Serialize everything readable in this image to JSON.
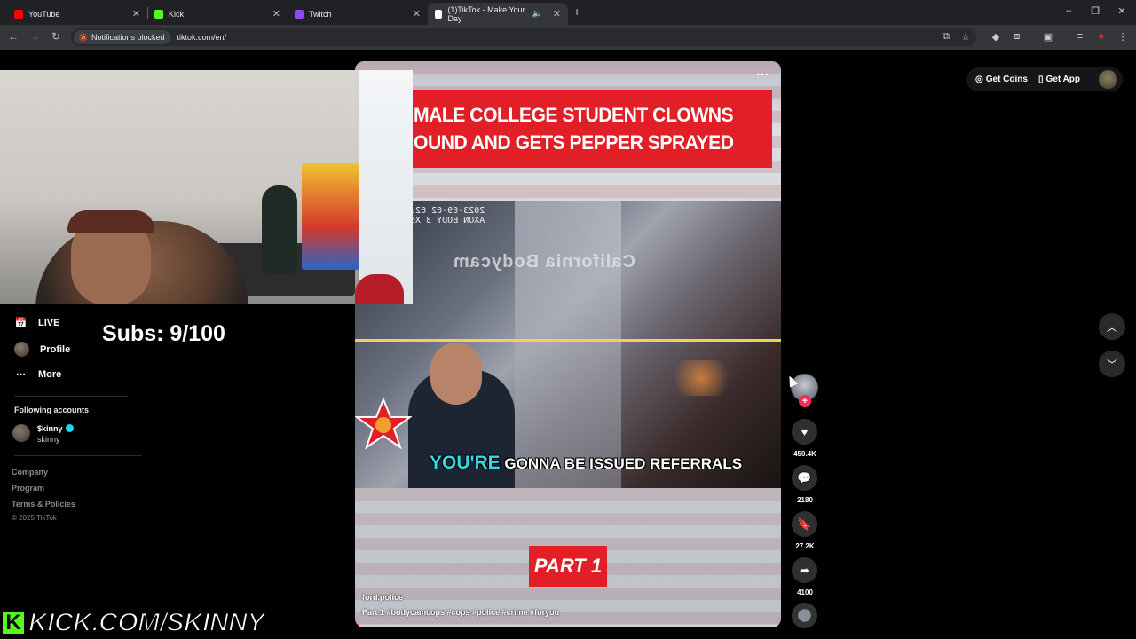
{
  "browser": {
    "tabs": [
      {
        "label": "YouTube",
        "fav_color": "#ff0000",
        "active": false
      },
      {
        "label": "Kick",
        "fav_color": "#53fc18",
        "active": false
      },
      {
        "label": "Twitch",
        "fav_color": "#9146ff",
        "active": false
      },
      {
        "label": "(1)TikTok - Make Your Day",
        "fav_color": "#ffffff",
        "active": true
      }
    ],
    "notifications_pill": "Notifications blocked",
    "url": "tiktok.com/en/"
  },
  "overlay": {
    "subs_text": "Subs: 9/100",
    "kick_logo_letter": "K",
    "kick_url": "KICK.COM/SKINNY"
  },
  "sidebar": {
    "items": [
      {
        "label": "LIVE",
        "icon": "live-icon"
      },
      {
        "label": "Profile",
        "icon": "profile-avatar"
      },
      {
        "label": "More",
        "icon": "more-icon"
      }
    ],
    "following_title": "Following accounts",
    "following": [
      {
        "name": "$kinny",
        "handle": "skinny",
        "verified": true
      }
    ],
    "footer_links": [
      "Company",
      "Program",
      "Terms & Policies"
    ],
    "copyright": "© 2025 TikTok"
  },
  "topbar": {
    "get_coins": "Get Coins",
    "get_app": "Get App"
  },
  "video": {
    "title_line1": "MALE COLLEGE STUDENT CLOWNS",
    "title_line2": "OUND AND GETS PEPPER SPRAYED",
    "timestamp_line1": "2023-09-02 02:",
    "timestamp_line2": "AXON BODY 3 X6",
    "watermark": "California Bodycam",
    "caption_highlight": "YOU'RE",
    "caption_rest": "GONNA BE ISSUED REFERRALS",
    "part_label": "PART 1",
    "author": "ford.police",
    "description": "Part 1 #bodycamcops #cops #police #crime #foryou",
    "progress_fraction": 0.01
  },
  "actions": {
    "likes": "450.4K",
    "comments": "2180",
    "saves": "27.2K",
    "shares": "4100"
  }
}
